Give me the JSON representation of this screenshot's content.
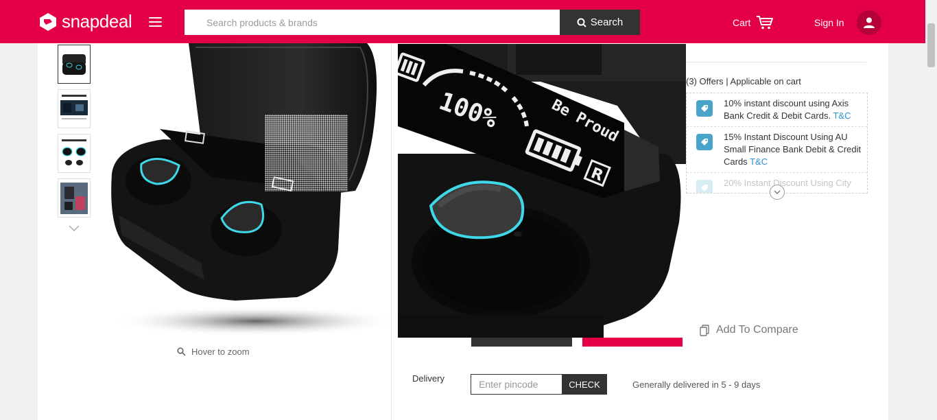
{
  "header": {
    "logo_text": "snapdeal",
    "search_placeholder": "Search products & brands",
    "search_button": "Search",
    "cart_label": "Cart",
    "signin_label": "Sign In"
  },
  "gallery": {
    "hover_hint": "Hover to zoom"
  },
  "offers": {
    "heading": "(3) Offers | Applicable on cart",
    "items": [
      {
        "text": "10% instant discount using Axis Bank Credit & Debit Cards.",
        "link": "T&C"
      },
      {
        "text": "15% Instant Discount Using AU Small Finance Bank Debit & Credit Cards",
        "link": "T&C"
      },
      {
        "text": "20% Instant Discount Using City"
      }
    ]
  },
  "actions": {
    "compare_label": "Add To Compare"
  },
  "delivery": {
    "label": "Delivery",
    "pincode_placeholder": "Enter pincode",
    "check_button": "CHECK",
    "note": "Generally delivered in 5 - 9 days"
  },
  "zoom": {
    "display_percent": "100%",
    "case_text": "Be Proud",
    "case_badge": "R"
  },
  "colors": {
    "brand": "#e40046",
    "dark": "#333333",
    "link": "#2b8ed9",
    "earbud_ring": "#3fd8e8"
  }
}
